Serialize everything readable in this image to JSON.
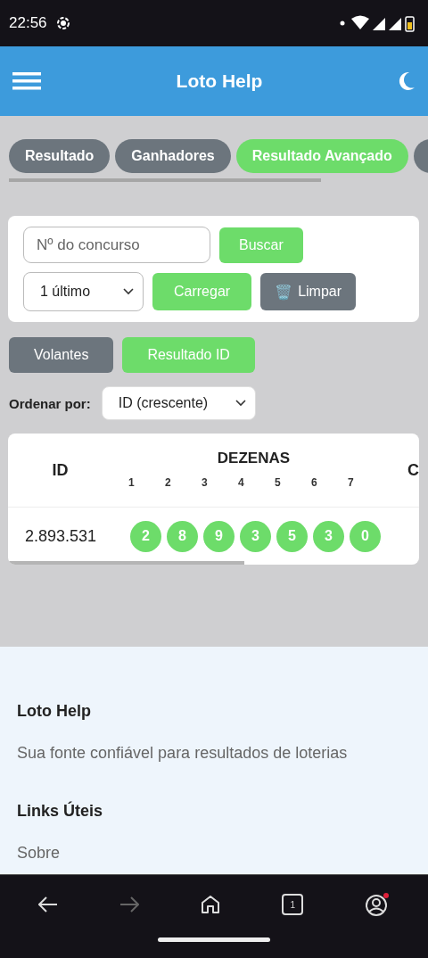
{
  "status_bar": {
    "time": "22:56"
  },
  "header": {
    "title": "Loto Help"
  },
  "tabs": [
    {
      "label": "Resultado",
      "selected": false
    },
    {
      "label": "Ganhadores",
      "selected": false
    },
    {
      "label": "Resultado Avançado",
      "selected": true
    },
    {
      "selected": false
    }
  ],
  "search_card": {
    "contest_field": {
      "placeholder": "Nº do concurso"
    },
    "search_button": "Buscar",
    "count_select": {
      "value": "1 último"
    },
    "load_button": "Carregar",
    "clear_button": {
      "icon": "🗑️",
      "label": "Limpar"
    }
  },
  "view_buttons": [
    {
      "label": "Volantes",
      "selected": false
    },
    {
      "label": "Resultado ID",
      "selected": true
    }
  ],
  "sort": {
    "label": "Ordenar por:",
    "value": "ID (crescente)"
  },
  "table": {
    "columns": [
      {
        "label": "ID"
      },
      {
        "label": "DEZENAS",
        "sub_labels": [
          "1",
          "2",
          "3",
          "4",
          "5",
          "6",
          "7"
        ]
      },
      {
        "label": "C"
      }
    ],
    "rows": [
      {
        "id": "2.893.531",
        "numbers": [
          "2",
          "8",
          "9",
          "3",
          "5",
          "3",
          "0"
        ]
      }
    ]
  },
  "footer": {
    "title": "Loto Help",
    "tagline": "Sua fonte confiável para resultados de loterias",
    "links_title": "Links Úteis",
    "links": [
      "Sobre"
    ]
  },
  "nav_bar": {
    "tab_count": "1",
    "forward_disabled": true,
    "account_notification": true
  }
}
